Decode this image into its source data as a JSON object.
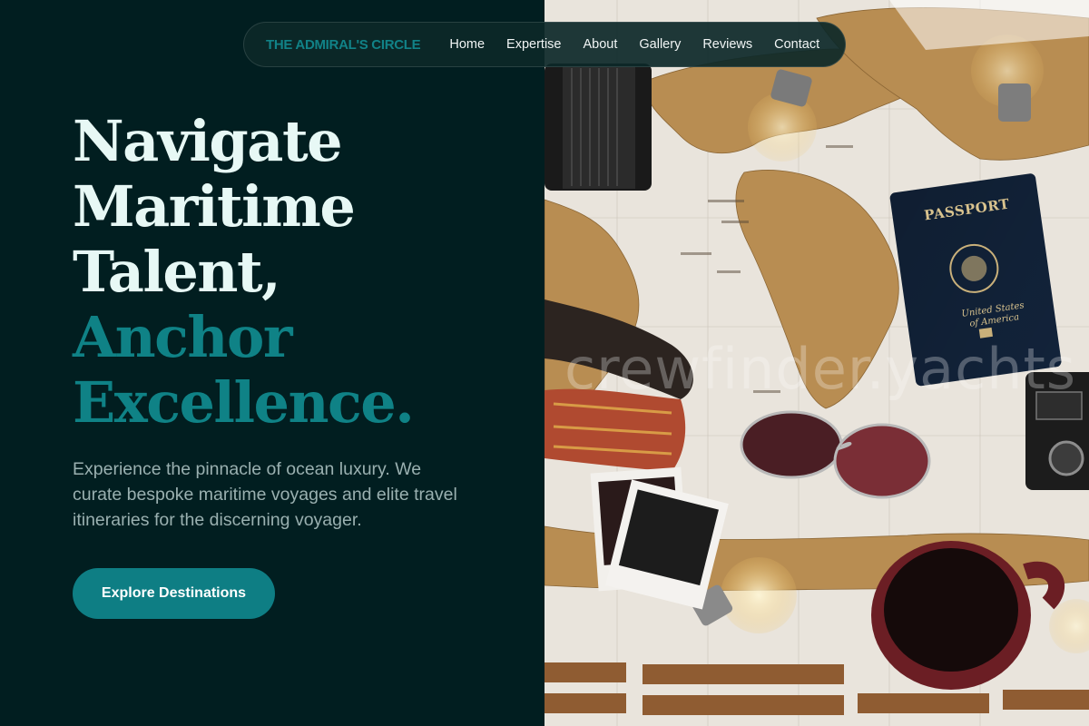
{
  "nav": {
    "brand": "THE ADMIRAL'S CIRCLE",
    "links": [
      "Home",
      "Expertise",
      "About",
      "Gallery",
      "Reviews",
      "Contact"
    ]
  },
  "hero": {
    "title_lines": [
      "Navigate",
      "Maritime",
      "Talent,"
    ],
    "accent_lines": [
      "Anchor",
      "Excellence."
    ],
    "description": "Experience the pinnacle of ocean luxury. We curate bespoke maritime voyages and elite travel itineraries for the discerning voyager.",
    "cta_label": "Explore Destinations"
  },
  "photo": {
    "watermark": "crewfinder.yachts",
    "passport_title": "PASSPORT",
    "passport_sub": "United States of America"
  },
  "colors": {
    "background": "#011e20",
    "accent": "#0f8286",
    "heading": "#e7f8f5",
    "body_text": "#9ab0b0"
  }
}
